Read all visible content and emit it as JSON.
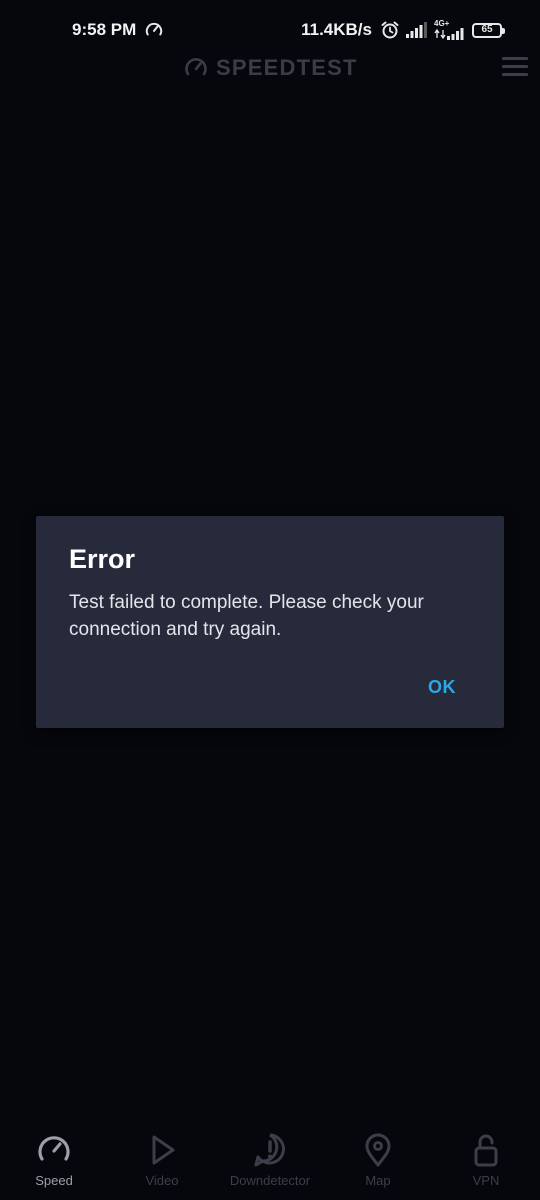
{
  "status_bar": {
    "time": "9:58 PM",
    "network_speed": "11.4KB/s",
    "network_type": "4G+",
    "battery": "65",
    "icons": [
      "speedtest-status-icon",
      "alarm-icon",
      "signal-icon",
      "signal-4g-icon",
      "battery-icon"
    ]
  },
  "header": {
    "app_name": "SPEEDTEST",
    "menu_icon": "hamburger-menu-icon"
  },
  "dialog": {
    "title": "Error",
    "message": "Test failed to complete. Please check your connection and try again.",
    "ok_label": "OK"
  },
  "bottom_nav": {
    "items": [
      {
        "label": "Speed",
        "icon": "speedometer-icon",
        "active": true
      },
      {
        "label": "Video",
        "icon": "play-icon",
        "active": false
      },
      {
        "label": "Downdetector",
        "icon": "alert-icon",
        "active": false
      },
      {
        "label": "Map",
        "icon": "map-pin-icon",
        "active": false
      },
      {
        "label": "VPN",
        "icon": "unlock-icon",
        "active": false
      }
    ]
  },
  "colors": {
    "background": "#06070c",
    "dialog": "#272a3a",
    "accent": "#2ea7e8"
  }
}
